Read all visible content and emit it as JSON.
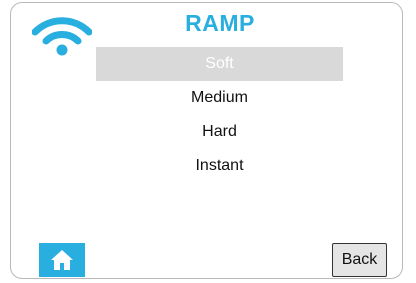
{
  "header": {
    "title": "RAMP",
    "title_color": "#29aee0",
    "wifi_icon": "wifi-icon"
  },
  "menu": {
    "items": [
      {
        "label": "Soft",
        "selected": true
      },
      {
        "label": "Medium",
        "selected": false
      },
      {
        "label": "Hard",
        "selected": false
      },
      {
        "label": "Instant",
        "selected": false
      }
    ],
    "selected_bg": "#d9d9d9"
  },
  "footer": {
    "home_icon": "home-icon",
    "home_bg": "#29aee0",
    "back_label": "Back"
  }
}
